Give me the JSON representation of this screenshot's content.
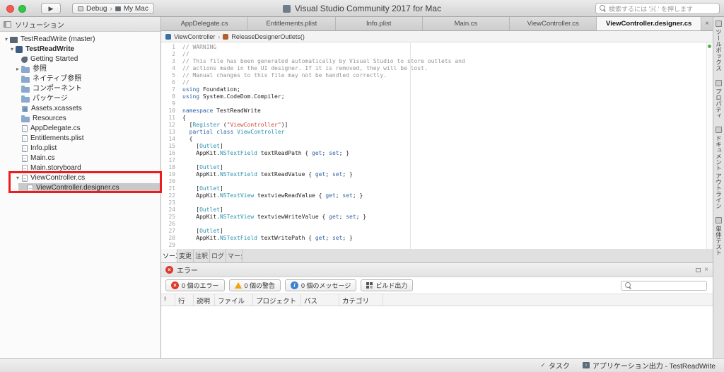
{
  "colors": {
    "comment": "#949494",
    "keyword": "#3364a4",
    "type": "#2b91af",
    "string": "#cf4b33",
    "selection": "#c9c9c9",
    "annotation": "#ee1c1c",
    "status_green": "#54b054",
    "error_red": "#dd3a2c",
    "warning_yellow": "#f0a30a",
    "info_blue": "#3b82d0"
  },
  "titlebar": {
    "run": "▶",
    "config": "Debug",
    "chevron": "›",
    "target": "My Mac",
    "title": "Visual Studio Community 2017 for Mac",
    "search_placeholder": "検索するには '⌘.' を押します"
  },
  "sidebar": {
    "title": "ソリューション",
    "items": [
      {
        "label": "TestReadWrite (master)",
        "depth": 0,
        "disclosure": "open",
        "icon": "solution"
      },
      {
        "label": "TestReadWrite",
        "depth": 1,
        "disclosure": "open",
        "icon": "project",
        "bold": true
      },
      {
        "label": "Getting Started",
        "depth": 2,
        "icon": "getting-started"
      },
      {
        "label": "参照",
        "depth": 2,
        "disclosure": "closed",
        "icon": "folder"
      },
      {
        "label": "ネイティブ参照",
        "depth": 2,
        "icon": "folder"
      },
      {
        "label": "コンポーネント",
        "depth": 2,
        "icon": "folder"
      },
      {
        "label": "パッケージ",
        "depth": 2,
        "icon": "folder"
      },
      {
        "label": "Assets.xcassets",
        "depth": 2,
        "icon": "assets"
      },
      {
        "label": "Resources",
        "depth": 2,
        "icon": "folder"
      },
      {
        "label": "AppDelegate.cs",
        "depth": 2,
        "icon": "file-cs"
      },
      {
        "label": "Entitlements.plist",
        "depth": 2,
        "icon": "file-plist"
      },
      {
        "label": "Info.plist",
        "depth": 2,
        "icon": "file-plist"
      },
      {
        "label": "Main.cs",
        "depth": 2,
        "icon": "file-cs"
      },
      {
        "label": "Main.storyboard",
        "depth": 2,
        "icon": "file-storyboard"
      },
      {
        "label": "ViewController.cs",
        "depth": 2,
        "disclosure": "open",
        "icon": "file-cs"
      },
      {
        "label": "ViewController.designer.cs",
        "depth": 3,
        "icon": "file-cs",
        "selected": true
      }
    ]
  },
  "editor": {
    "tabs": [
      {
        "label": "AppDelegate.cs"
      },
      {
        "label": "Entitlements.plist"
      },
      {
        "label": "Info.plist"
      },
      {
        "label": "Main.cs"
      },
      {
        "label": "ViewController.cs"
      },
      {
        "label": "ViewController.designer.cs",
        "active": true
      }
    ],
    "close": "×",
    "breadcrumb": [
      {
        "label": "ViewController",
        "icon": "class"
      },
      {
        "label": "ReleaseDesignerOutlets()",
        "icon": "method"
      }
    ],
    "code": {
      "lines": [
        {
          "n": "1",
          "s": [
            [
              "cm",
              "// WARNING"
            ]
          ]
        },
        {
          "n": "2",
          "s": [
            [
              "cm",
              "//"
            ]
          ]
        },
        {
          "n": "3",
          "s": [
            [
              "cm",
              "// This file has been generated automatically by Visual Studio to store outlets and"
            ]
          ]
        },
        {
          "n": "4",
          "s": [
            [
              "cm",
              "// actions made in the UI designer. If it is removed, they will be lost."
            ]
          ]
        },
        {
          "n": "5",
          "s": [
            [
              "cm",
              "// Manual changes to this file may not be handled correctly."
            ]
          ]
        },
        {
          "n": "6",
          "s": [
            [
              "cm",
              "//"
            ]
          ]
        },
        {
          "n": "7",
          "s": [
            [
              "kw",
              "using"
            ],
            [
              "pl",
              " Foundation;"
            ]
          ]
        },
        {
          "n": "8",
          "s": [
            [
              "kw",
              "using"
            ],
            [
              "pl",
              " System.CodeDom.Compiler;"
            ]
          ]
        },
        {
          "n": "9",
          "s": []
        },
        {
          "n": "10",
          "s": [
            [
              "kw",
              "namespace"
            ],
            [
              "pl",
              " TestReadWrite"
            ]
          ]
        },
        {
          "n": "11",
          "s": [
            [
              "pl",
              "{"
            ]
          ]
        },
        {
          "n": "12",
          "s": [
            [
              "pl",
              "  ["
            ],
            [
              "ty",
              "Register"
            ],
            [
              "pl",
              " ("
            ],
            [
              "st",
              "\"ViewController\""
            ],
            [
              "pl",
              ")]"
            ]
          ]
        },
        {
          "n": "13",
          "s": [
            [
              "pl",
              "  "
            ],
            [
              "kw",
              "partial"
            ],
            [
              "pl",
              " "
            ],
            [
              "kw",
              "class"
            ],
            [
              "pl",
              " "
            ],
            [
              "ty",
              "ViewController"
            ]
          ]
        },
        {
          "n": "14",
          "s": [
            [
              "pl",
              "  {"
            ]
          ]
        },
        {
          "n": "15",
          "s": [
            [
              "pl",
              "    ["
            ],
            [
              "ty",
              "Outlet"
            ],
            [
              "pl",
              "]"
            ]
          ]
        },
        {
          "n": "16",
          "s": [
            [
              "pl",
              "    AppKit."
            ],
            [
              "ty",
              "NSTextField"
            ],
            [
              "pl",
              " textReadPath { "
            ],
            [
              "kw",
              "get"
            ],
            [
              "pl",
              "; "
            ],
            [
              "kw",
              "set"
            ],
            [
              "pl",
              "; }"
            ]
          ]
        },
        {
          "n": "17",
          "s": []
        },
        {
          "n": "18",
          "s": [
            [
              "pl",
              "    ["
            ],
            [
              "ty",
              "Outlet"
            ],
            [
              "pl",
              "]"
            ]
          ]
        },
        {
          "n": "19",
          "s": [
            [
              "pl",
              "    AppKit."
            ],
            [
              "ty",
              "NSTextField"
            ],
            [
              "pl",
              " textReadValue { "
            ],
            [
              "kw",
              "get"
            ],
            [
              "pl",
              "; "
            ],
            [
              "kw",
              "set"
            ],
            [
              "pl",
              "; }"
            ]
          ]
        },
        {
          "n": "20",
          "s": []
        },
        {
          "n": "21",
          "s": [
            [
              "pl",
              "    ["
            ],
            [
              "ty",
              "Outlet"
            ],
            [
              "pl",
              "]"
            ]
          ]
        },
        {
          "n": "22",
          "s": [
            [
              "pl",
              "    AppKit."
            ],
            [
              "ty",
              "NSTextView"
            ],
            [
              "pl",
              " textviewReadValue { "
            ],
            [
              "kw",
              "get"
            ],
            [
              "pl",
              "; "
            ],
            [
              "kw",
              "set"
            ],
            [
              "pl",
              "; }"
            ]
          ]
        },
        {
          "n": "23",
          "s": []
        },
        {
          "n": "24",
          "s": [
            [
              "pl",
              "    ["
            ],
            [
              "ty",
              "Outlet"
            ],
            [
              "pl",
              "]"
            ]
          ]
        },
        {
          "n": "25",
          "s": [
            [
              "pl",
              "    AppKit."
            ],
            [
              "ty",
              "NSTextView"
            ],
            [
              "pl",
              " textviewWriteValue { "
            ],
            [
              "kw",
              "get"
            ],
            [
              "pl",
              "; "
            ],
            [
              "kw",
              "set"
            ],
            [
              "pl",
              "; }"
            ]
          ]
        },
        {
          "n": "26",
          "s": []
        },
        {
          "n": "27",
          "s": [
            [
              "pl",
              "    ["
            ],
            [
              "ty",
              "Outlet"
            ],
            [
              "pl",
              "]"
            ]
          ]
        },
        {
          "n": "28",
          "s": [
            [
              "pl",
              "    AppKit."
            ],
            [
              "ty",
              "NSTextField"
            ],
            [
              "pl",
              " textWritePath { "
            ],
            [
              "kw",
              "get"
            ],
            [
              "pl",
              "; "
            ],
            [
              "kw",
              "set"
            ],
            [
              "pl",
              "; }"
            ]
          ]
        },
        {
          "n": "29",
          "s": []
        }
      ]
    }
  },
  "vcs_tabs": [
    {
      "label": "ソース",
      "active": true
    },
    {
      "label": "変更"
    },
    {
      "label": "注釈"
    },
    {
      "label": "ログ"
    },
    {
      "label": "マージ"
    }
  ],
  "error_panel": {
    "title": "エラー",
    "close": "×",
    "filters": [
      {
        "icon": "error",
        "label": "0 個のエラー"
      },
      {
        "icon": "warning",
        "label": "0 個の警告"
      },
      {
        "icon": "info",
        "label": "0 個のメッセージ"
      }
    ],
    "build_output": "ビルド出力",
    "columns": [
      "!",
      "行",
      "説明",
      "ファイル",
      "プロジェクト",
      "パス",
      "カテゴリ"
    ]
  },
  "right_tabs": [
    {
      "label": "ツールボックス",
      "icon": "toolbox"
    },
    {
      "label": "プロパティ",
      "icon": "properties"
    },
    {
      "label": "ドキュメント アウトライン",
      "icon": "document-outline"
    },
    {
      "label": "単体テスト",
      "icon": "unit-tests"
    }
  ],
  "statusbar": {
    "tasks": "タスク",
    "app_output": "アプリケーション出力 - TestReadWrite"
  }
}
